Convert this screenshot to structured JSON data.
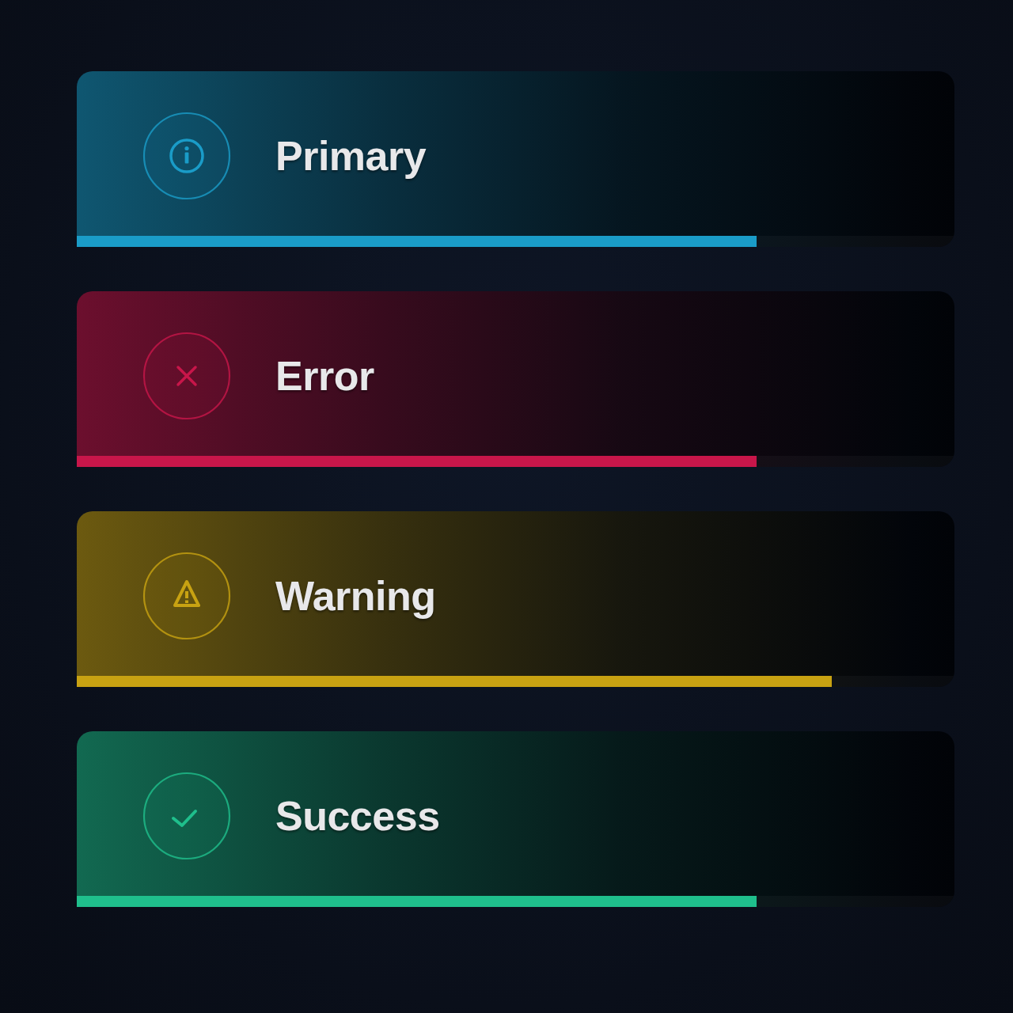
{
  "toasts": [
    {
      "kind": "info",
      "title": "Primary",
      "color": "#1a9cc8",
      "level": 0.775
    },
    {
      "kind": "error",
      "title": "Error",
      "color": "#c8164a",
      "level": 0.775
    },
    {
      "kind": "warning",
      "title": "Warning",
      "color": "#c8a212",
      "level": 0.86
    },
    {
      "kind": "success",
      "title": "Success",
      "color": "#1fbf8c",
      "level": 0.775
    }
  ]
}
